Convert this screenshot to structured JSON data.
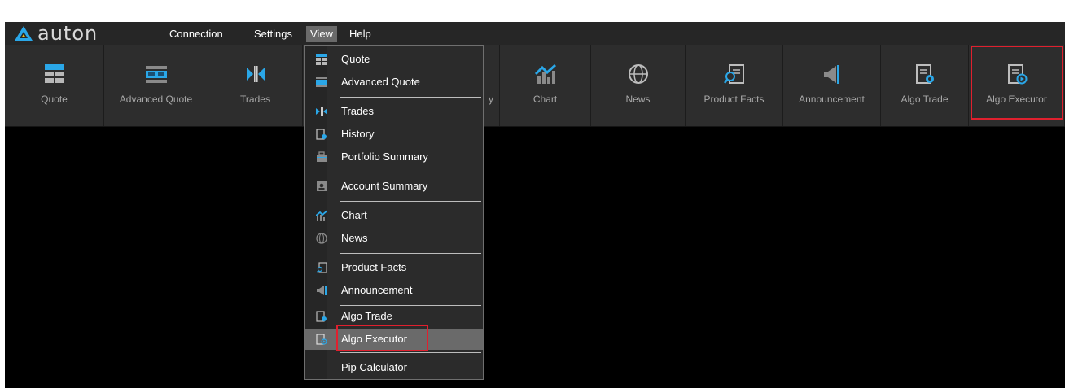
{
  "app": {
    "logo_text": "auton",
    "accent_color": "#2aa7e8",
    "highlight_color": "#e0202e"
  },
  "menubar": {
    "items": [
      {
        "id": "connection",
        "label": "Connection"
      },
      {
        "id": "settings",
        "label": "Settings"
      },
      {
        "id": "view",
        "label": "View",
        "active": true
      },
      {
        "id": "help",
        "label": "Help"
      }
    ]
  },
  "toolbar": {
    "buttons": [
      {
        "label": "Quote",
        "icon": "quote-icon"
      },
      {
        "label": "Advanced Quote",
        "icon": "advanced-quote-icon"
      },
      {
        "label": "Trades",
        "icon": "trades-icon"
      },
      {
        "label": "y",
        "icon": "portfolio-icon"
      },
      {
        "label": "Chart",
        "icon": "chart-icon"
      },
      {
        "label": "News",
        "icon": "news-icon"
      },
      {
        "label": "Product Facts",
        "icon": "product-facts-icon"
      },
      {
        "label": "Announcement",
        "icon": "announcement-icon"
      },
      {
        "label": "Algo Trade",
        "icon": "algo-trade-icon"
      },
      {
        "label": "Algo Executor",
        "icon": "algo-executor-icon",
        "highlighted": true
      }
    ]
  },
  "view_menu": {
    "items": [
      {
        "label": "Quote",
        "icon": "quote-icon"
      },
      {
        "label": "Advanced Quote",
        "icon": "advanced-quote-icon"
      },
      {
        "label": "Trades",
        "icon": "trades-icon"
      },
      {
        "label": "History",
        "icon": "history-icon"
      },
      {
        "label": "Portfolio Summary",
        "icon": "portfolio-icon"
      },
      {
        "label": "Account Summary",
        "icon": "account-summary-icon"
      },
      {
        "label": "Chart",
        "icon": "chart-icon"
      },
      {
        "label": "News",
        "icon": "news-icon"
      },
      {
        "label": "Product Facts",
        "icon": "product-facts-icon"
      },
      {
        "label": "Announcement",
        "icon": "announcement-icon"
      },
      {
        "label": "Algo Trade",
        "icon": "algo-trade-icon"
      },
      {
        "label": "Algo Executor",
        "icon": "algo-executor-icon",
        "selected": true,
        "highlighted": true
      },
      {
        "label": "Pip Calculator",
        "icon": ""
      }
    ]
  }
}
